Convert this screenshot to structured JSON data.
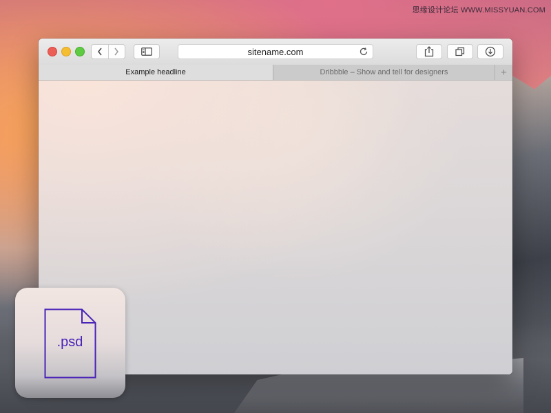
{
  "watermark": "思缘设计论坛 WWW.MISSYUAN.COM",
  "browser": {
    "address": "sitename.com",
    "tabs": [
      {
        "label": "Example headline",
        "active": true
      },
      {
        "label": "Dribbble – Show and tell for designers",
        "active": false
      }
    ],
    "new_tab_label": "+"
  },
  "icons": {
    "close": "close-traffic-icon",
    "minimize": "minimize-traffic-icon",
    "maximize": "maximize-traffic-icon",
    "back": "chevron-left-icon",
    "forward": "chevron-right-icon",
    "sidebar": "sidebar-icon",
    "reload": "reload-icon",
    "share": "share-icon",
    "tabs": "tabs-overview-icon",
    "downloads": "download-icon",
    "file": "psd-file-icon"
  },
  "colors": {
    "close": "#ec5f57",
    "minimize": "#f5be30",
    "maximize": "#5fcb43",
    "psd_accent": "#4a23b8"
  },
  "psd_badge": {
    "label": ".psd"
  }
}
